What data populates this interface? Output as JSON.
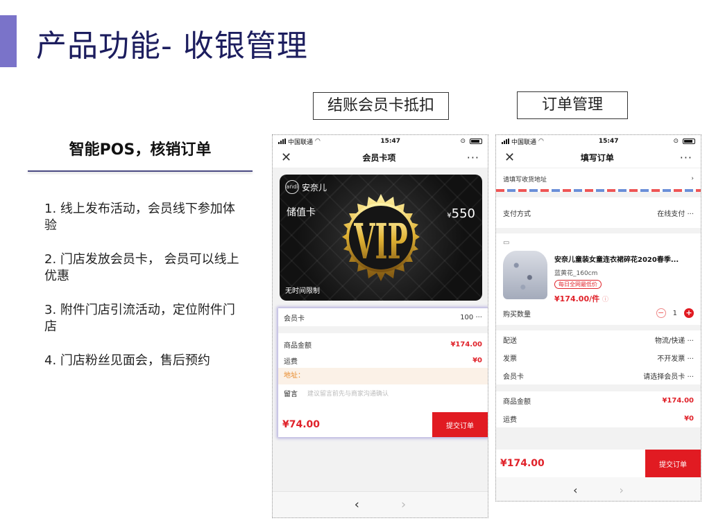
{
  "slide": {
    "title": "产品功能- 收银管理"
  },
  "tags": {
    "left": "结账会员卡抵扣",
    "right": "订单管理"
  },
  "features": {
    "heading": "智能POS，核销订单",
    "items": [
      "1. 线上发布活动，会员线下参加体验",
      "2. 门店发放会员卡， 会员可以线上优惠",
      "3. 附件门店引流活动，定位附件门店",
      "4. 门店粉丝见面会，售后预约"
    ]
  },
  "phone_left": {
    "status": {
      "carrier": "中国联通",
      "time": "15:47"
    },
    "nav_title": "会员卡项",
    "close_icon": "close-icon",
    "more_icon": "more-icon",
    "card": {
      "logo": "andi",
      "brand": "安奈儿",
      "type": "储值卡",
      "currency": "¥",
      "balance": "550",
      "limit": "无时间限制",
      "emblem": "VIP"
    },
    "member": {
      "label": "会员卡",
      "value": "100 ···",
      "goods_label": "商品金额",
      "goods_value": "¥174.00",
      "ship_label": "运费",
      "ship_value": "¥0",
      "address": "地址：",
      "note_label": "留言",
      "note_placeholder": "建议留言前先与商家沟通确认",
      "total": "¥74.00",
      "submit": "提交订单"
    },
    "bottom_nav": {
      "back": "‹",
      "forward": "›"
    }
  },
  "phone_right": {
    "status": {
      "carrier": "中国联通",
      "time": "15:47"
    },
    "nav_title": "填写订单",
    "address": "请填写收货地址",
    "address_arrow": "›",
    "pay_label": "支付方式",
    "pay_value": "在线支付 ···",
    "store_icon": "store-icon",
    "product": {
      "name": "安奈儿童装女童连衣裙碎花2020春季...",
      "spec": "蓝黄花_160cm",
      "badge": "每日全网最低价",
      "price": "¥174.00/件",
      "info": "ⓘ"
    },
    "qty_label": "购买数量",
    "qty": "1",
    "delivery_label": "配送",
    "delivery_value": "物流/快递 ···",
    "invoice_label": "发票",
    "invoice_value": "不开发票 ···",
    "member_label": "会员卡",
    "member_value": "请选择会员卡 ···",
    "goods_label": "商品金额",
    "goods_value": "¥174.00",
    "ship_label": "运费",
    "ship_value": "¥0",
    "total": "¥174.00",
    "submit": "提交订单",
    "bottom_nav": {
      "back": "‹",
      "forward": "›"
    }
  },
  "colors": {
    "accent": "#7a73c9",
    "title": "#1c1d5e",
    "price_red": "#e0222a"
  }
}
